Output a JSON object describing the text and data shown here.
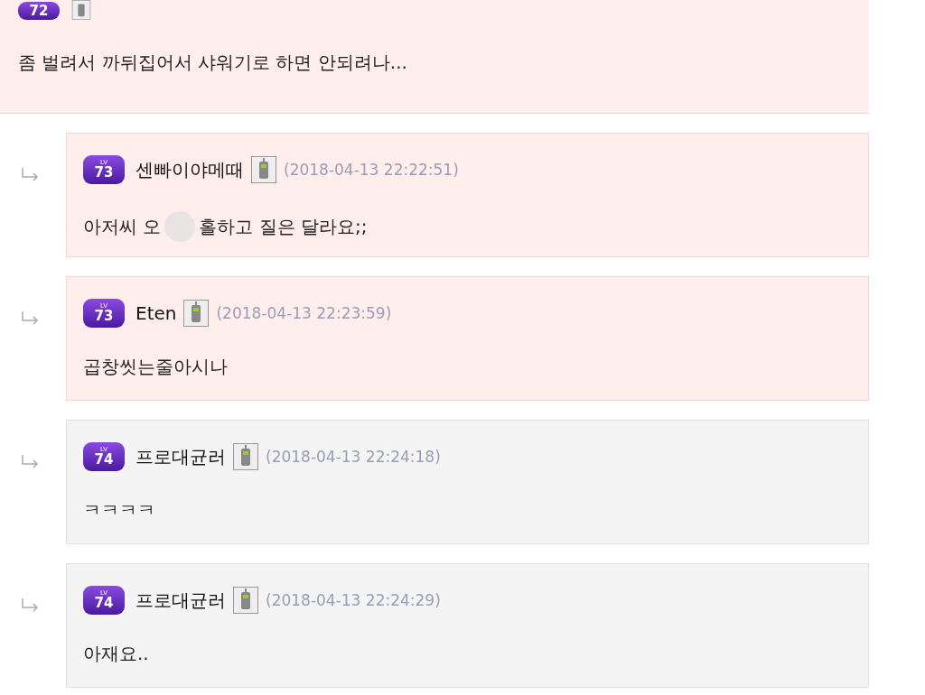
{
  "parent_comment": {
    "rank": "72",
    "highlighted": true,
    "body": "좀 벌려서 까뒤집어서 샤워기로 하면 안되려나..."
  },
  "replies": [
    {
      "badge_tag": "LV",
      "rank": "73",
      "author": "센빠이야메때",
      "date": "(2018-04-13 22:22:51)",
      "highlighted": true,
      "body": [
        "아저씨 오",
        "홀하고 질은 달라요;;"
      ]
    },
    {
      "badge_tag": "LV",
      "rank": "73",
      "author": "Eten",
      "date": "(2018-04-13 22:23:59)",
      "highlighted": true,
      "body": [
        "곱창씻는줄아시나"
      ]
    },
    {
      "badge_tag": "LV",
      "rank": "74",
      "author": "프로대균러",
      "date": "(2018-04-13 22:24:18)",
      "highlighted": false,
      "body": [
        "ㅋㅋㅋㅋ"
      ]
    },
    {
      "badge_tag": "LV",
      "rank": "74",
      "author": "프로대균러",
      "date": "(2018-04-13 22:24:29)",
      "highlighted": false,
      "body": [
        "아재요.."
      ]
    }
  ]
}
